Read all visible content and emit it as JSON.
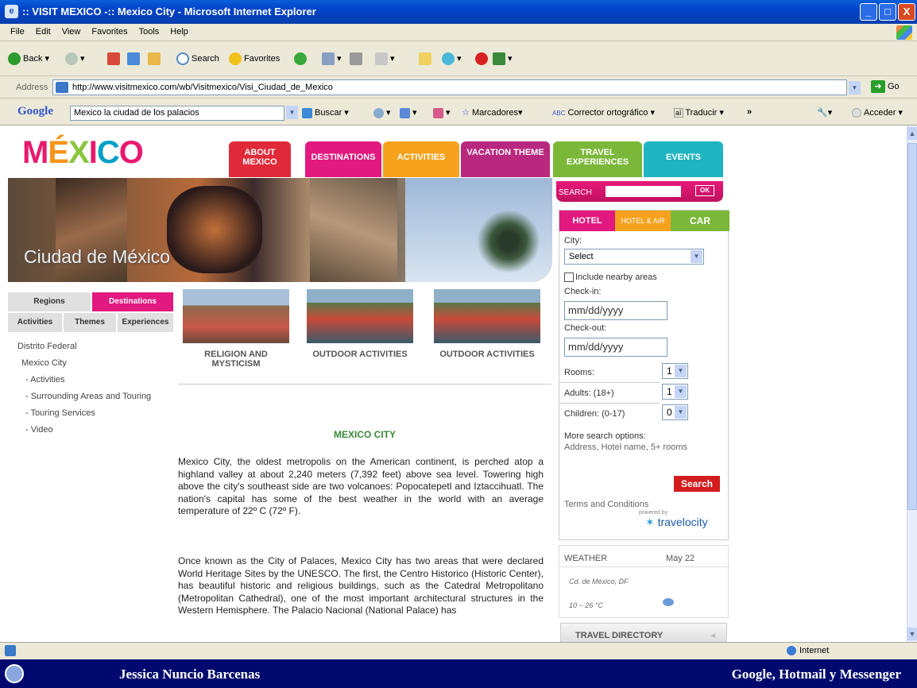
{
  "window": {
    "title": ":: VISIT MEXICO -:: Mexico City - Microsoft Internet Explorer",
    "min": "_",
    "max": "□",
    "close": "X"
  },
  "menu": [
    "File",
    "Edit",
    "View",
    "Favorites",
    "Tools",
    "Help"
  ],
  "toolbar": {
    "back": "Back",
    "search": "Search",
    "favorites": "Favorites"
  },
  "address": {
    "label": "Address",
    "url": "http://www.visitmexico.com/wb/Visitmexico/Visi_Ciudad_de_Mexico",
    "go": "Go"
  },
  "googlebar": {
    "logo": "Google",
    "query": "Mexico la ciudad de los palacios",
    "buscar": "Buscar",
    "marcadores": "Marcadores",
    "corrector": "Corrector ortográfico",
    "traducir": "Traducir",
    "more": "»",
    "acceder": "Acceder"
  },
  "page": {
    "logo": {
      "m": "M",
      "e": "É",
      "x": "X",
      "i": "I",
      "c": "C",
      "o": "O"
    },
    "nav": [
      "ABOUT MEXICO",
      "DESTINATIONS",
      "ACTIVITIES",
      "VACATION THEME",
      "TRAVEL EXPERIENCES",
      "EVENTS"
    ],
    "hero_caption": "Ciudad de México",
    "search": {
      "label": "SEARCH",
      "ok": "OK"
    },
    "subnav": {
      "regions": "Regions",
      "destinations": "Destinations",
      "activities": "Activities",
      "themes": "Themes",
      "experiences": "Experiences"
    },
    "leftlinks": [
      "Distrito Federal",
      "Mexico City",
      "- Activities",
      "- Surrounding Areas and Touring",
      "- Touring Services",
      "- Video"
    ],
    "thumbs": [
      "RELIGION AND MYSTICISM",
      "OUTDOOR ACTIVITIES",
      "OUTDOOR ACTIVITIES"
    ],
    "article_title": "MEXICO CITY",
    "para1": "Mexico City, the oldest metropolis on the American continent, is perched atop a highland valley at about 2,240 meters (7,392 feet) above sea level. Towering high above the city's southeast side are two volcanoes: Popocatepetl and Iztaccihuatl. The nation's capital has some of the best weather in the world with an average temperature of 22º C (72º F).",
    "para2": "Once known as the City of Palaces, Mexico City has two areas that were declared World Heritage Sites by the UNESCO. The first, the Centro Historico (Historic Center), has beautiful historic and religious buildings, such as the Catedral Metropolitano (Metropolitan Cathedral), one of the most important architectural structures in the Western Hemisphere. The Palacio Nacional (National Palace) has",
    "booking": {
      "tabs": [
        "HOTEL",
        "HOTEL & AIR",
        "CAR"
      ],
      "city_label": "City:",
      "city_value": "Select",
      "nearby": "Include nearby areas",
      "checkin_label": "Check-in:",
      "checkin_value": "mm/dd/yyyy",
      "checkout_label": "Check-out:",
      "checkout_value": "mm/dd/yyyy",
      "rooms_label": "Rooms:",
      "rooms_value": "1",
      "adults_label": "Adults: (18+)",
      "adults_value": "1",
      "children_label": "Children: (0-17)",
      "children_value": "0",
      "more_options": "More search options:",
      "more_options_detail": "Address, Hotel name, 5+ rooms",
      "search_btn": "Search",
      "terms": "Terms and Conditions",
      "powered": "powered by",
      "travelocity": "travelocity"
    },
    "weather": {
      "label": "WEATHER",
      "date": "May 22",
      "place": "Cd. de México, DF",
      "temp": "10 ~ 26 °C"
    },
    "travel_directory": "TRAVEL DIRECTORY"
  },
  "status": {
    "zone": "Internet"
  },
  "taskbar": {
    "left": "Jessica Nuncio Barcenas",
    "right": "Google, Hotmail y Messenger"
  }
}
